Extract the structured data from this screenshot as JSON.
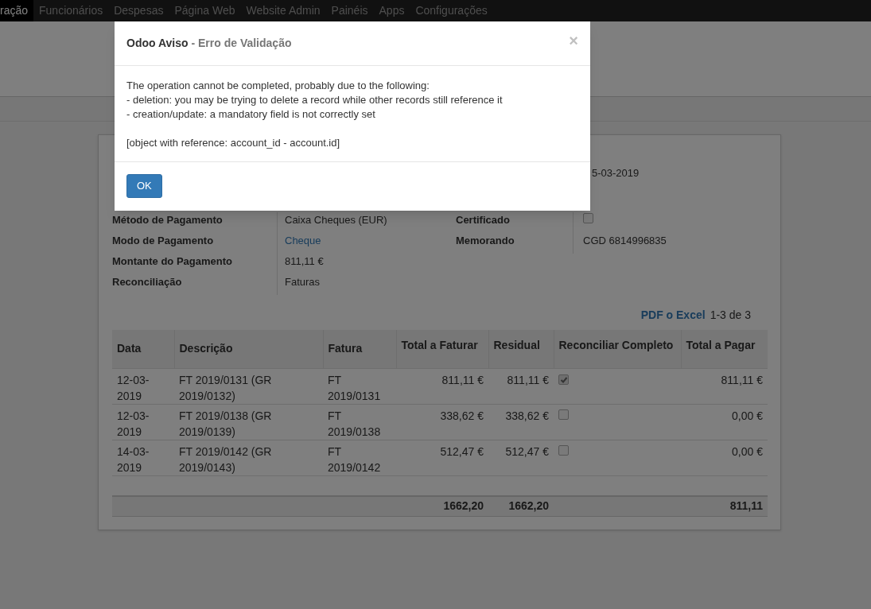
{
  "navbar": {
    "menu": [
      {
        "label": "ração",
        "selected": true
      },
      {
        "label": "Funcionários",
        "selected": false
      },
      {
        "label": "Despesas",
        "selected": false
      },
      {
        "label": "Página Web",
        "selected": false
      },
      {
        "label": "Website Admin",
        "selected": false
      },
      {
        "label": "Painéis",
        "selected": false
      },
      {
        "label": "Apps",
        "selected": false
      },
      {
        "label": "Configurações",
        "selected": false
      }
    ]
  },
  "form": {
    "date_value": "5-03-2019",
    "left_fields": [
      {
        "label": "Método de Pagamento",
        "value": "Caixa Cheques (EUR)",
        "kind": "text"
      },
      {
        "label": "Modo de Pagamento",
        "value": "Cheque",
        "kind": "link"
      },
      {
        "label": "Montante do Pagamento",
        "value": "811,11 €",
        "kind": "text"
      },
      {
        "label": "Reconciliação",
        "value": "Faturas",
        "kind": "text"
      }
    ],
    "right_fields": [
      {
        "label": "Certificado",
        "kind": "checkbox",
        "checked": false
      },
      {
        "label": "Memorando",
        "kind": "text",
        "value": "CGD 6814996835"
      }
    ],
    "export_link": "PDF o Excel",
    "pager": "1-3 de 3",
    "table": {
      "columns": [
        "Data",
        "Descrição",
        "Fatura",
        "Total a Faturar",
        "Residual",
        "Reconciliar Completo",
        "Total a Pagar"
      ],
      "rows": [
        {
          "date": "12-03-2019",
          "description": "FT 2019/0131 (GR 2019/0132)",
          "invoice": "FT 2019/0131",
          "total": "811,11 €",
          "residual": "811,11 €",
          "reconcile": true,
          "to_pay": "811,11 €"
        },
        {
          "date": "12-03-2019",
          "description": "FT 2019/0138 (GR 2019/0139)",
          "invoice": "FT 2019/0138",
          "total": "338,62 €",
          "residual": "338,62 €",
          "reconcile": false,
          "to_pay": "0,00 €"
        },
        {
          "date": "14-03-2019",
          "description": "FT 2019/0142 (GR 2019/0143)",
          "invoice": "FT 2019/0142",
          "total": "512,47 €",
          "residual": "512,47 €",
          "reconcile": false,
          "to_pay": "0,00 €"
        }
      ],
      "totals": {
        "total": "1662,20",
        "residual": "1662,20",
        "to_pay": "811,11"
      }
    }
  },
  "dialog": {
    "title": "Odoo Aviso",
    "subtitle": "- Erro de Validação",
    "close": "×",
    "message": [
      "The operation cannot be completed, probably due to the following:",
      "- deletion: you may be trying to delete a record while other records still reference it",
      "- creation/update: a mandatory field is not correctly set"
    ],
    "detail": "[object with reference: account_id - account.id]",
    "button": "OK"
  }
}
